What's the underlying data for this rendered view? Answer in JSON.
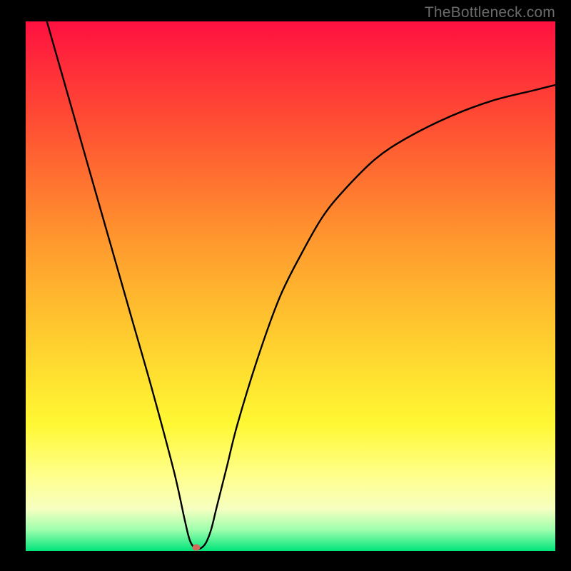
{
  "watermark": "TheBottleneck.com",
  "chart_data": {
    "type": "line",
    "title": "",
    "xlabel": "",
    "ylabel": "",
    "xlim": [
      0,
      100
    ],
    "ylim": [
      0,
      100
    ],
    "grid": false,
    "legend": false,
    "series": [
      {
        "name": "bottleneck-curve",
        "x": [
          4,
          8,
          12,
          16,
          20,
          24,
          28,
          30,
          31,
          32,
          33,
          34,
          35,
          36,
          38,
          40,
          44,
          48,
          52,
          56,
          60,
          66,
          72,
          80,
          88,
          96,
          100
        ],
        "y": [
          100,
          86,
          72,
          58,
          44,
          30,
          15,
          6,
          2,
          0.5,
          0.5,
          1.5,
          4,
          8,
          16,
          24,
          37,
          48,
          56,
          63,
          68,
          74,
          78,
          82,
          85,
          87,
          88
        ]
      }
    ],
    "marker": {
      "x": 32.2,
      "y": 0.7,
      "name": "optimal-point"
    },
    "background_gradient": {
      "orientation": "vertical",
      "stops": [
        {
          "pos": 0.0,
          "color": "#ff1040"
        },
        {
          "pos": 0.3,
          "color": "#ff7230"
        },
        {
          "pos": 0.66,
          "color": "#ffde30"
        },
        {
          "pos": 0.92,
          "color": "#f6ffc0"
        },
        {
          "pos": 1.0,
          "color": "#00e47a"
        }
      ]
    }
  }
}
